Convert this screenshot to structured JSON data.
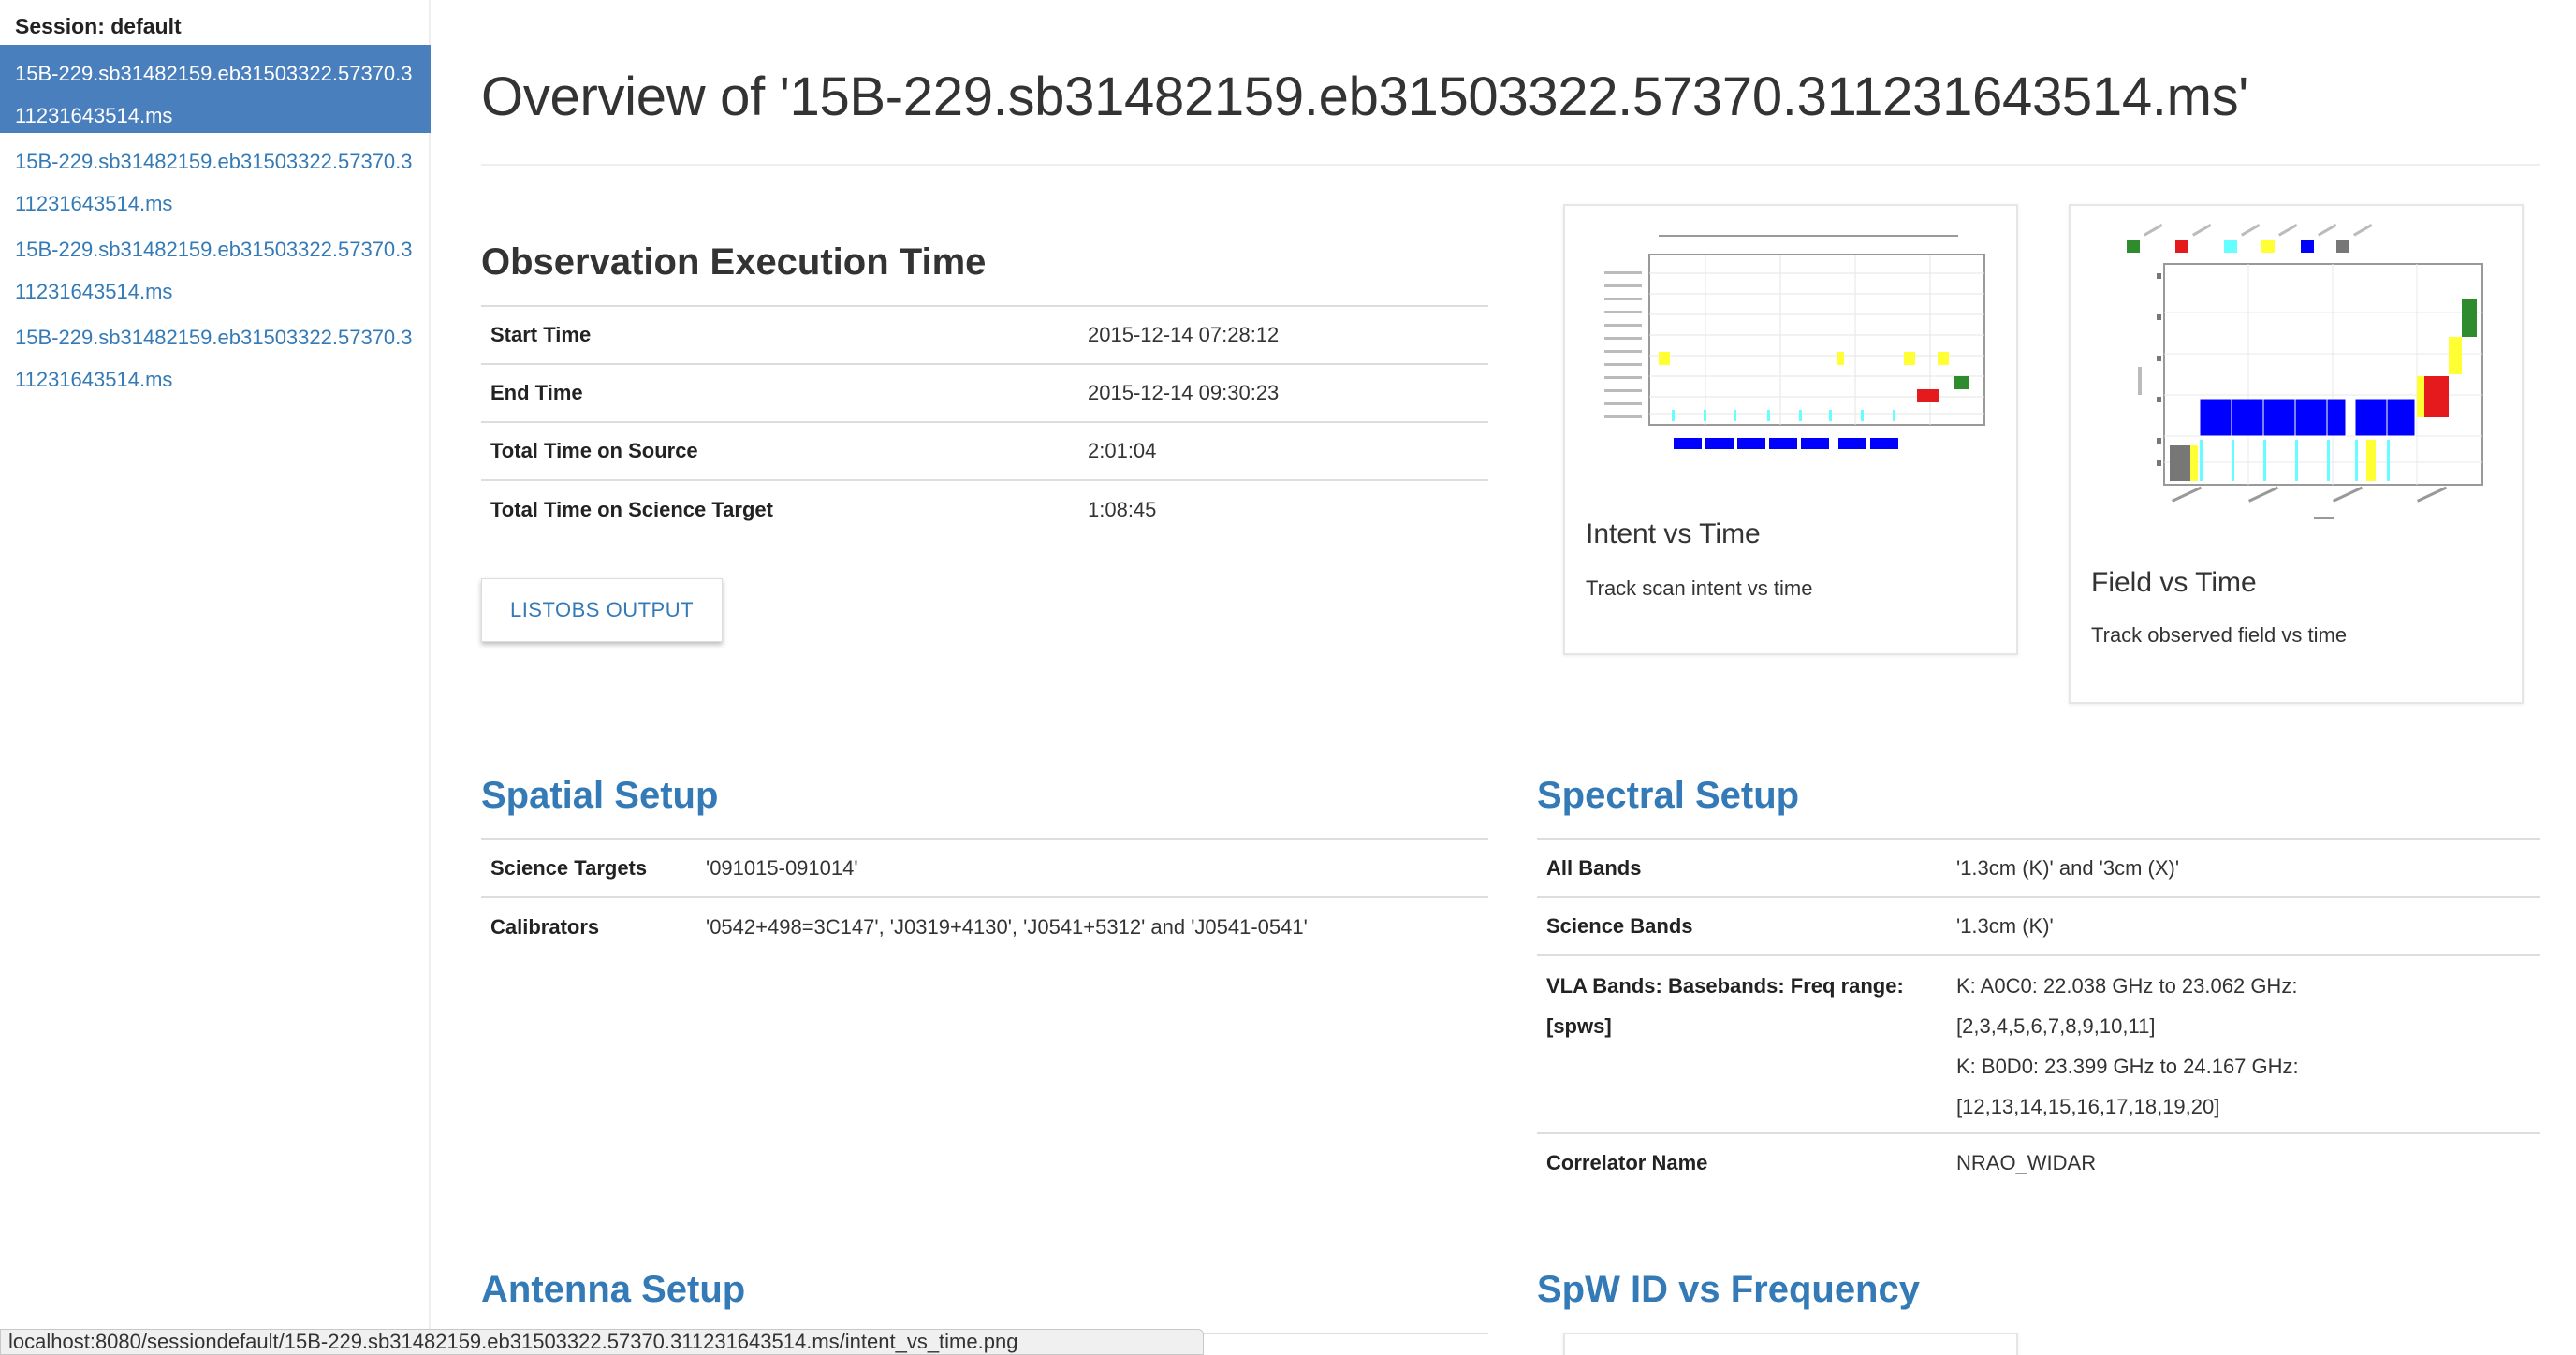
{
  "sidebar": {
    "session_label": "Session: default",
    "items": [
      {
        "label": "15B-229.sb31482159.eb31503322.57370.311231643514.ms",
        "active": true
      },
      {
        "label": "15B-229.sb31482159.eb31503322.57370.311231643514.ms",
        "active": false
      },
      {
        "label": "15B-229.sb31482159.eb31503322.57370.311231643514.ms",
        "active": false
      },
      {
        "label": "15B-229.sb31482159.eb31503322.57370.311231643514.ms",
        "active": false
      }
    ]
  },
  "main": {
    "title": "Overview of '15B-229.sb31482159.eb31503322.57370.311231643514.ms'",
    "execution": {
      "heading": "Observation Execution Time",
      "rows": [
        {
          "key": "Start Time",
          "value": "2015-12-14 07:28:12"
        },
        {
          "key": "End Time",
          "value": "2015-12-14 09:30:23"
        },
        {
          "key": "Total Time on Source",
          "value": "2:01:04"
        },
        {
          "key": "Total Time on Science Target",
          "value": "1:08:45"
        }
      ],
      "listobs_button": "LISTOBS OUTPUT"
    },
    "cards": {
      "intent": {
        "title": "Intent vs Time",
        "desc": "Track scan intent vs time"
      },
      "field": {
        "title": "Field vs Time",
        "desc": "Track observed field vs time"
      }
    },
    "spatial": {
      "heading": "Spatial Setup",
      "rows": [
        {
          "key": "Science Targets",
          "value": "'091015-091014'"
        },
        {
          "key": "Calibrators",
          "value": "'0542+498=3C147', 'J0319+4130', 'J0541+5312' and 'J0541-0541'"
        }
      ]
    },
    "spectral": {
      "heading": "Spectral Setup",
      "rows": [
        {
          "key": "All Bands",
          "value": "'1.3cm (K)' and '3cm (X)'"
        },
        {
          "key": "Science Bands",
          "value": "'1.3cm (K)'"
        },
        {
          "key": "VLA Bands: Basebands: Freq range: [spws]",
          "value_lines": [
            "K: A0C0: 22.038 GHz to 23.062 GHz:",
            "[2,3,4,5,6,7,8,9,10,11]",
            "K: B0D0: 23.399 GHz to 24.167 GHz:",
            "[12,13,14,15,16,17,18,19,20]"
          ]
        },
        {
          "key": "Correlator Name",
          "value": "NRAO_WIDAR"
        }
      ]
    },
    "antenna": {
      "heading": "Antenna Setup"
    },
    "spw": {
      "heading": "SpW ID vs Frequency"
    }
  },
  "status_url": "localhost:8080/sessiondefault/15B-229.sb31482159.eb31503322.57370.311231643514.ms/intent_vs_time.png",
  "colors": {
    "link": "#337ab7",
    "active_bg": "#4a7fbd",
    "plot_blue": "#0000ff",
    "plot_yellow": "#ffff33",
    "plot_red": "#e41a1c",
    "plot_green": "#2e8b2e",
    "plot_cyan": "#66ffff",
    "plot_grey": "#777777"
  }
}
